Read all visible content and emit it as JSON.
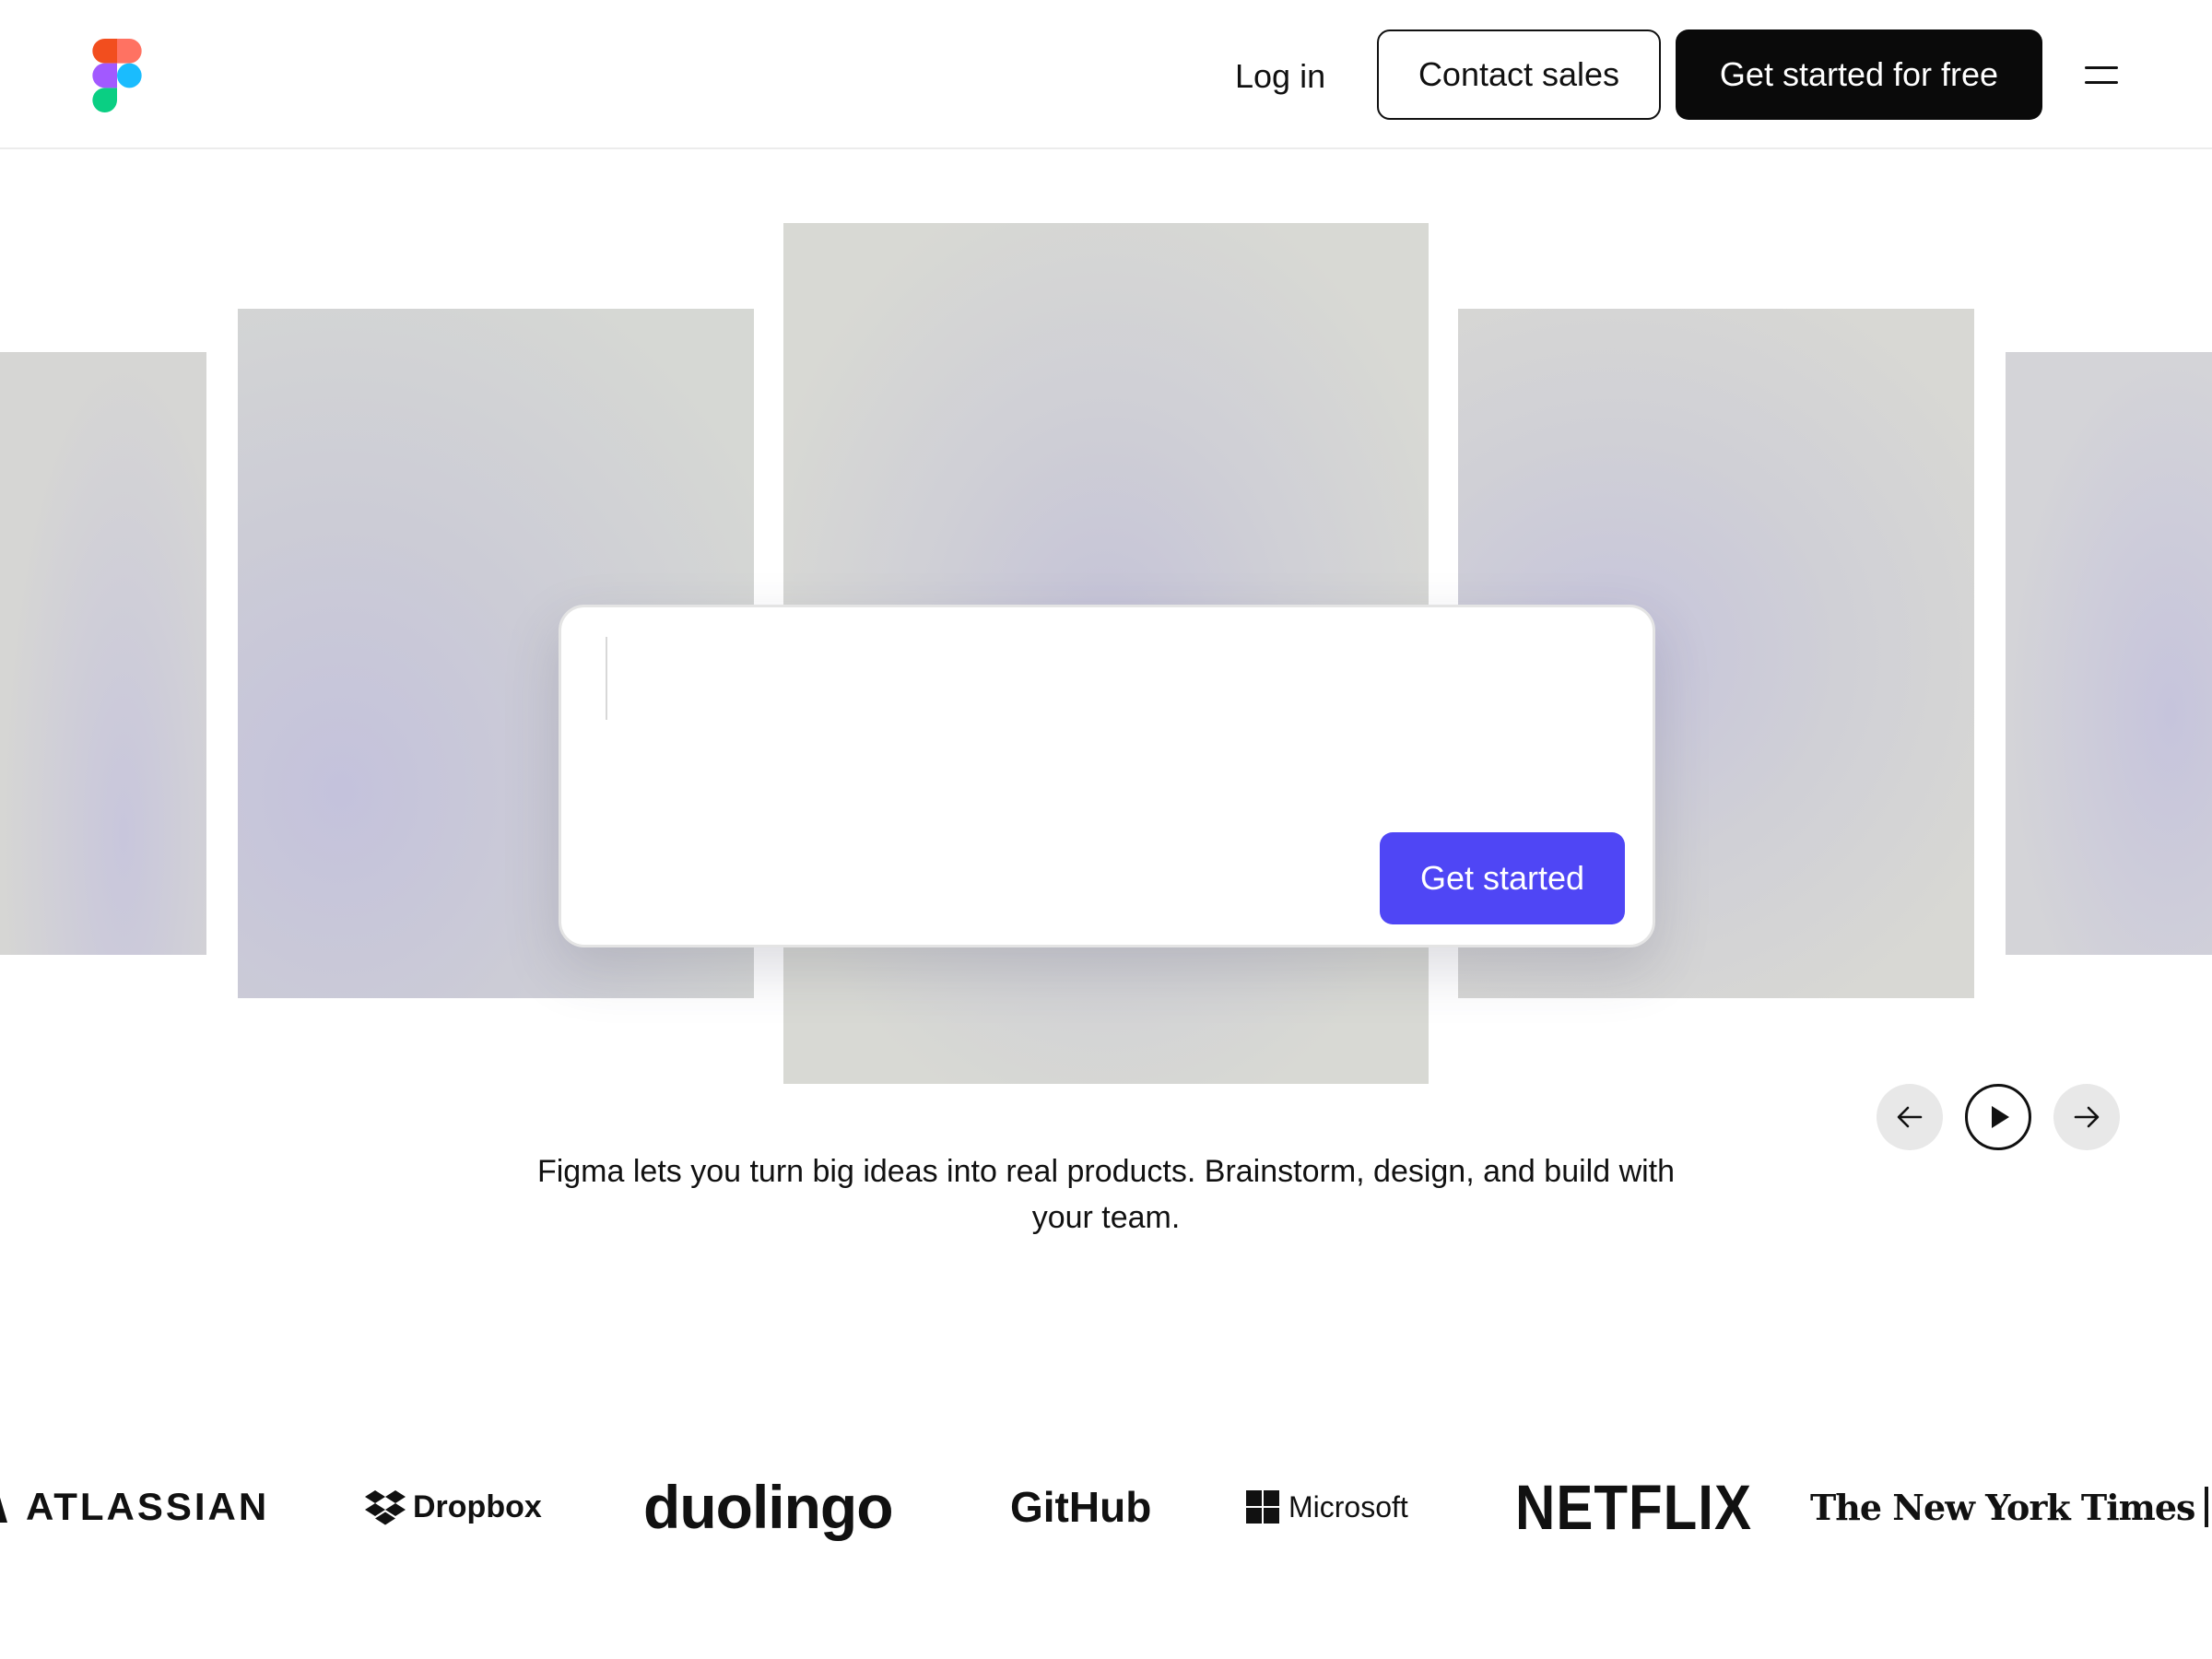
{
  "header": {
    "logo_icon": "figma-logo-icon",
    "login_label": "Log in",
    "contact_sales_label": "Contact sales",
    "get_started_free_label": "Get started for free",
    "menu_icon": "hamburger-menu-icon"
  },
  "prompt": {
    "input_value": "",
    "submit_label": "Get started",
    "accent_color": "#4f46f5"
  },
  "carousel": {
    "prev_icon": "arrow-left-icon",
    "play_icon": "play-icon",
    "next_icon": "arrow-right-icon"
  },
  "tagline": "Figma lets you turn big ideas into real products. Brainstorm, design, and build with your team.",
  "logos": {
    "atlassian": "ATLASSIAN",
    "dropbox": "Dropbox",
    "duolingo": "duolingo",
    "github": "GitHub",
    "microsoft": "Microsoft",
    "netflix": "NETFLIX",
    "nyt": "The New York Times"
  }
}
